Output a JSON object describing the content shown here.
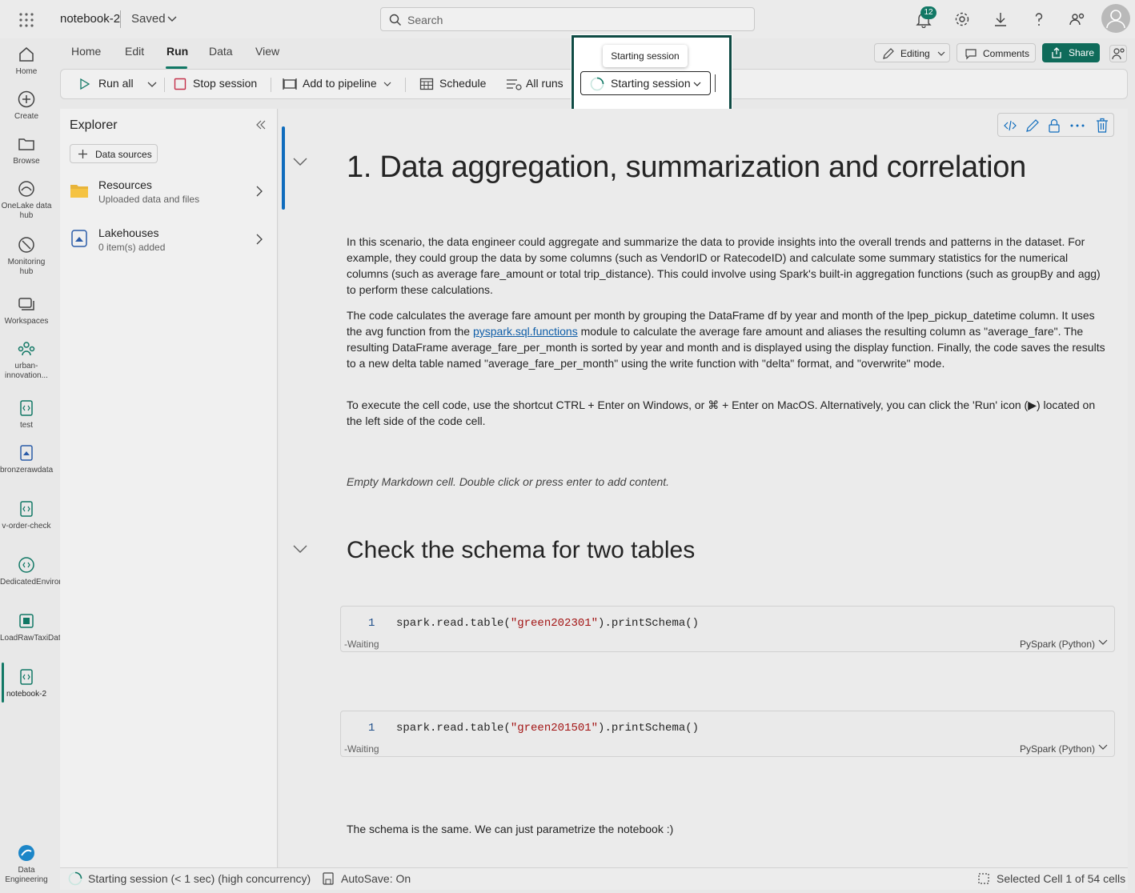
{
  "topbar": {
    "notebook_name": "notebook-2",
    "save_status": "Saved",
    "search_placeholder": "Search",
    "notification_count": "12",
    "icons": [
      "waffle-icon",
      "bell-icon",
      "gear-icon",
      "download-icon",
      "help-icon",
      "share-people-icon",
      "avatar"
    ]
  },
  "rail": {
    "items": [
      {
        "label": "Home",
        "icon": "home-icon"
      },
      {
        "label": "Create",
        "icon": "plus-circle-icon"
      },
      {
        "label": "Browse",
        "icon": "folder-icon"
      },
      {
        "label": "OneLake data hub",
        "icon": "onelake-icon"
      },
      {
        "label": "Monitoring hub",
        "icon": "monitor-icon"
      },
      {
        "label": "Workspaces",
        "icon": "workspaces-icon"
      },
      {
        "label": "urban-innovation...",
        "icon": "people-icon"
      },
      {
        "label": "test",
        "icon": "notebook-icon"
      },
      {
        "label": "bronzerawdata",
        "icon": "lakehouse-icon"
      },
      {
        "label": "v-order-check",
        "icon": "notebook-icon"
      },
      {
        "label": "DedicatedEnvironment...",
        "icon": "environment-icon"
      },
      {
        "label": "LoadRawTaxiData",
        "icon": "pipeline-icon"
      },
      {
        "label": "notebook-2",
        "icon": "notebook-icon"
      }
    ],
    "footer_label": "Data Engineering"
  },
  "menu": {
    "tabs": [
      "Home",
      "Edit",
      "Run",
      "Data",
      "View"
    ],
    "active_tab": "Run",
    "editing_label": "Editing",
    "comments_label": "Comments",
    "share_label": "Share"
  },
  "toolbar": {
    "run_all": "Run all",
    "stop_session": "Stop session",
    "add_to_pipeline": "Add to pipeline",
    "schedule": "Schedule",
    "all_runs": "All runs",
    "session_button": "Starting session",
    "session_tooltip": "Starting session"
  },
  "explorer": {
    "title": "Explorer",
    "data_sources": "Data sources",
    "items": [
      {
        "title": "Resources",
        "subtitle": "Uploaded data and files"
      },
      {
        "title": "Lakehouses",
        "subtitle": "0 item(s) added"
      }
    ]
  },
  "notebook": {
    "heading1": "1. Data aggregation, summarization and correlation",
    "para1": "In this scenario, the data engineer could aggregate and summarize the data to provide insights into the overall trends and patterns in the dataset. For example, they could group the data by some columns (such as VendorID or RatecodeID) and calculate some summary statistics for the numerical columns (such as average fare_amount or total trip_distance). This could involve using Spark's built-in aggregation functions (such as groupBy and agg) to perform these calculations.",
    "para2_before": "The code calculates the average fare amount per month by grouping the DataFrame df by year and month of the lpep_pickup_datetime column. It uses the avg function from the ",
    "para2_link": "pyspark.sql.functions",
    "para2_after": " module to calculate the average fare amount and aliases the resulting column as \"average_fare\". The resulting DataFrame average_fare_per_month is sorted by year and month and is displayed using the display function. Finally, the code saves the results to a new delta table named \"average_fare_per_month\" using the write function with \"delta\" format, and \"overwrite\" mode.",
    "para3": "To execute the cell code, use the shortcut CTRL + Enter on Windows, or ⌘ + Enter on MacOS. Alternatively, you can click the 'Run' icon (▶) located on the left side of the code cell.",
    "empty_md": "Empty Markdown cell. Double click or press enter to add content.",
    "heading2": "Check the schema for two tables",
    "code_cells": [
      {
        "line": "1",
        "pre": "spark.read.table(",
        "str": "\"green202301\"",
        "post": ").printSchema()",
        "status": "-Waiting",
        "lang": "PySpark (Python)"
      },
      {
        "line": "1",
        "pre": "spark.read.table(",
        "str": "\"green201501\"",
        "post": ").printSchema()",
        "status": "-Waiting",
        "lang": "PySpark (Python)"
      }
    ],
    "footer_text": "The schema is the same. We can just parametrize the notebook :)"
  },
  "statusbar": {
    "session": "Starting session (< 1 sec) (high concurrency)",
    "autosave": "AutoSave: On",
    "selection": "Selected Cell 1 of 54 cells"
  },
  "colors": {
    "accent": "#117865",
    "highlight_border": "#0f4b44",
    "link": "#0f5ea8",
    "string": "#a31515"
  }
}
